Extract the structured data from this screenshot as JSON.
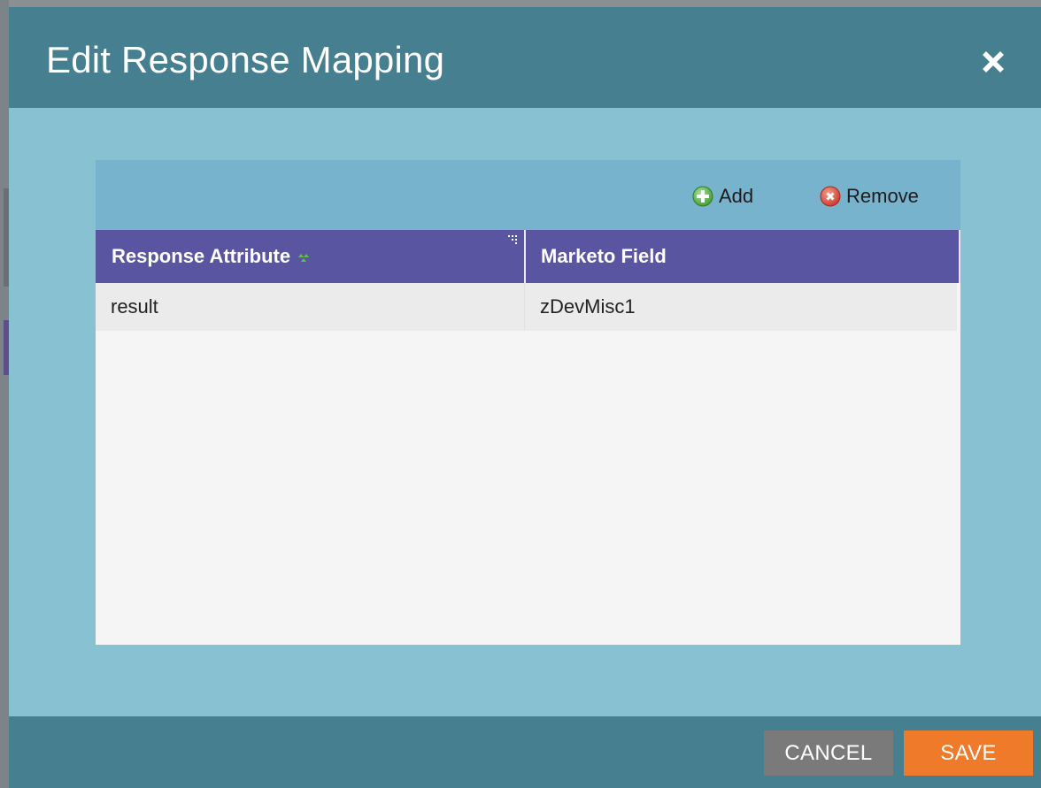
{
  "dialog": {
    "title": "Edit Response Mapping",
    "close_icon": "close-icon"
  },
  "toolbar": {
    "add_label": "Add",
    "add_icon": "plus-circle-icon",
    "remove_label": "Remove",
    "remove_icon": "x-circle-icon"
  },
  "grid": {
    "columns": [
      {
        "label": "Response Attribute",
        "sorted": true
      },
      {
        "label": "Marketo Field",
        "sorted": false
      }
    ],
    "rows": [
      {
        "attribute": "result",
        "field": "zDevMisc1"
      }
    ]
  },
  "footer": {
    "cancel_label": "CANCEL",
    "save_label": "SAVE"
  },
  "colors": {
    "header_bg": "#467f8f",
    "body_bg": "#88c1d2",
    "toolbar_bg": "#78b3cd",
    "grid_header_bg": "#5a55a0",
    "cancel_bg": "#7a7a7a",
    "save_bg": "#ee7a2a"
  }
}
